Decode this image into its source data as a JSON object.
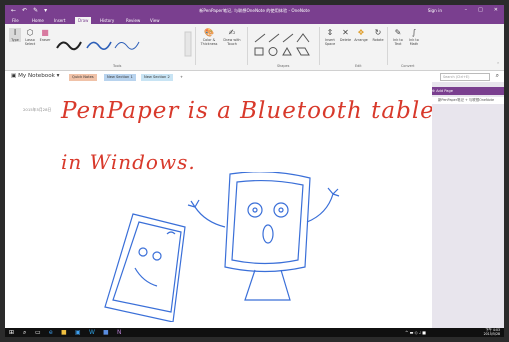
{
  "window": {
    "title": "新PenPaper笔记, 与联想OneNote 的使用体验 - OneNote",
    "sign_in": "Sign in",
    "qat": [
      "←",
      "↶",
      "✎",
      "▾"
    ],
    "controls": [
      "–",
      "□",
      "✕"
    ]
  },
  "ribbon_tabs": [
    "File",
    "Home",
    "Insert",
    "Draw",
    "History",
    "Review",
    "View"
  ],
  "active_tab": "Draw",
  "ribbon": {
    "tools": {
      "type": "Type",
      "lasso": "Lasso Select",
      "eraser": "Eraser",
      "group_label": "Tools"
    },
    "color": {
      "label": "Color & Thickness"
    },
    "pen_touch": {
      "label": "Draw with Touch"
    },
    "shapes_label": "Shapes",
    "insert_space": "Insert Space",
    "delete": "Delete",
    "arrange": "Arrange",
    "rotate": "Rotate",
    "edit_label": "Edit",
    "ink_to_text": "Ink to Text",
    "ink_to_math": "Ink to Math",
    "convert_label": "Convert"
  },
  "notebook": {
    "name": "My Notebook",
    "sections": [
      "Quick Notes",
      "New Section 1",
      "New Section 2"
    ],
    "add_section": "+",
    "search_placeholder": "Search (Ctrl+E)"
  },
  "page": {
    "date": "2015年5月28日",
    "handwriting_line1": "PenPaper is a Bluetooth tablet",
    "handwriting_line2": "in Windows."
  },
  "pages_pane": {
    "add_page": "Add Page",
    "items": [
      "新PenPaper笔记 + 与联想OneNote"
    ]
  },
  "taskbar": {
    "clock_time": "下午 4:03",
    "clock_date": "2015/5/28"
  },
  "colors": {
    "accent": "#7a3f8f",
    "ink": "#d8392b",
    "sketch": "#3a6fd8"
  }
}
